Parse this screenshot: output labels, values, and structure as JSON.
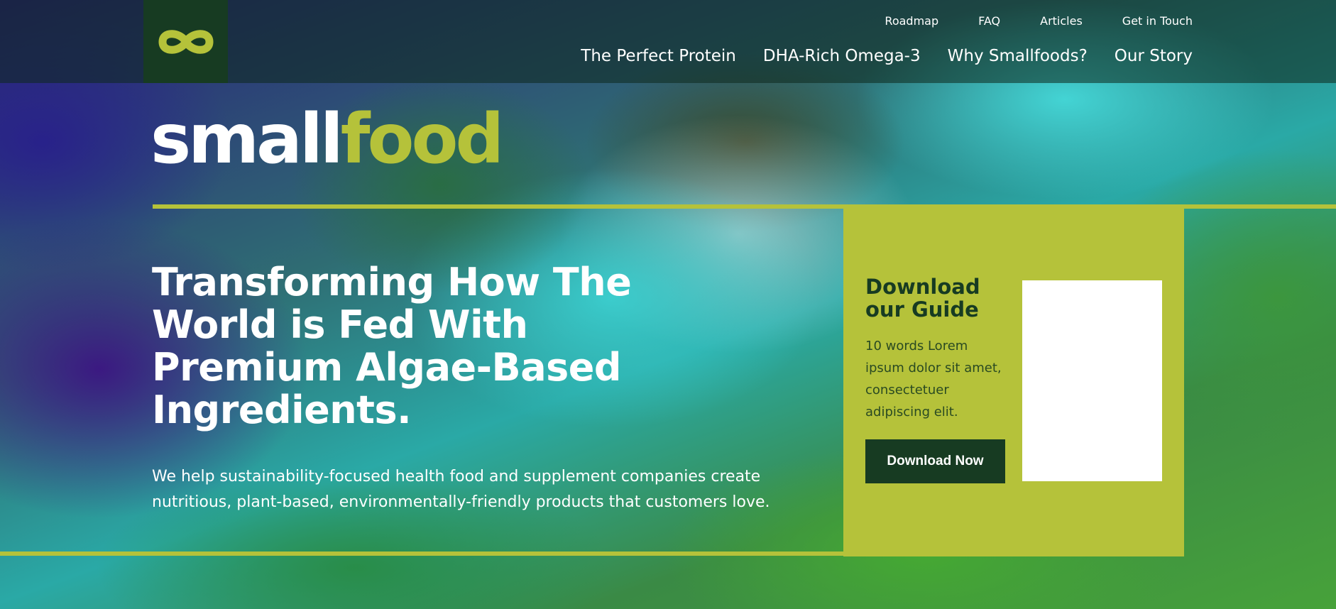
{
  "header": {
    "logo_icon": "infinity-logo-icon",
    "top_nav": [
      {
        "label": "Roadmap"
      },
      {
        "label": "FAQ"
      },
      {
        "label": "Articles"
      },
      {
        "label": "Get in Touch"
      }
    ],
    "main_nav": [
      {
        "label": "The Perfect Protein"
      },
      {
        "label": "DHA-Rich Omega-3"
      },
      {
        "label": "Why Smallfoods?"
      },
      {
        "label": "Our Story"
      }
    ]
  },
  "brand": {
    "wordmark_part1": "small",
    "wordmark_part2": "food",
    "primary_color": "#b5c23a",
    "dark_color": "#173b22"
  },
  "hero": {
    "title": "Transforming How The World is Fed With Premium Algae-Based Ingredients.",
    "subtitle": "We help sustainability-focused health food and supplement companies create nutritious, plant-based, environmentally-friendly products that customers love."
  },
  "guide": {
    "title": "Download our Guide",
    "text": "10 words Lorem ipsum dolor sit amet, consectetuer adipiscing elit.",
    "button_label": "Download Now"
  }
}
